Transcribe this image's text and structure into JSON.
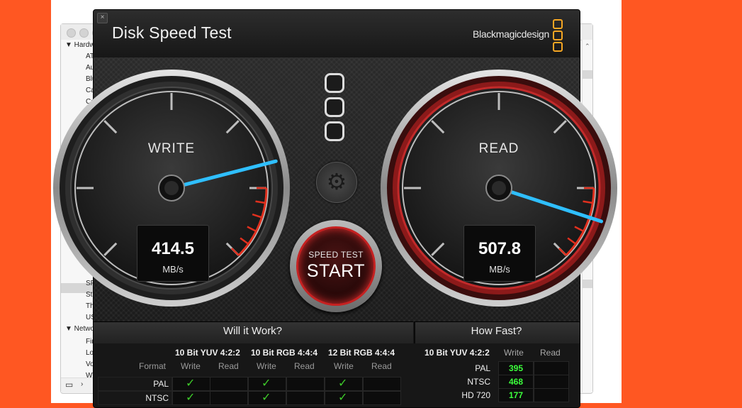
{
  "background_window": {
    "sidebar": [
      {
        "text": "Hardware",
        "type": "header"
      },
      {
        "text": "ATA",
        "type": "item"
      },
      {
        "text": "Audio",
        "type": "item"
      },
      {
        "text": "Bluetooth",
        "type": "item"
      },
      {
        "text": "Camera",
        "type": "item"
      },
      {
        "text": "Card Reader",
        "type": "item"
      },
      {
        "text": "SPI",
        "type": "item"
      },
      {
        "text": "Storage",
        "type": "item"
      },
      {
        "text": "Thunderbolt",
        "type": "item"
      },
      {
        "text": "USB",
        "type": "item"
      },
      {
        "text": "Network",
        "type": "header"
      },
      {
        "text": "Firewall",
        "type": "item"
      },
      {
        "text": "Locations",
        "type": "item"
      },
      {
        "text": "Volumes",
        "type": "item"
      },
      {
        "text": "WWAN",
        "type": "item"
      }
    ]
  },
  "app": {
    "title": "Disk Speed Test",
    "brand": "Blackmagicdesign",
    "close_glyph": "×",
    "icons": {
      "settings": "gear-icon",
      "presets": "stacked-squares-icon"
    }
  },
  "gauges": {
    "write": {
      "label": "WRITE",
      "value": "414.5",
      "unit": "MB/s",
      "needle_fraction": 0.78,
      "ring_color": "#2a2a2a"
    },
    "read": {
      "label": "READ",
      "value": "507.8",
      "unit": "MB/s",
      "needle_fraction": 0.9,
      "ring_color": "#7a1414"
    }
  },
  "start_button": {
    "small": "SPEED TEST",
    "big": "START"
  },
  "will_it_work": {
    "title": "Will it Work?",
    "format_header": "Format",
    "groups": [
      {
        "name": "10 Bit YUV 4:2:2",
        "write": "Write",
        "read": "Read"
      },
      {
        "name": "10 Bit RGB 4:4:4",
        "write": "Write",
        "read": "Read"
      },
      {
        "name": "12 Bit RGB 4:4:4",
        "write": "Write",
        "read": "Read"
      }
    ],
    "rows": [
      {
        "format": "PAL",
        "checks": [
          true,
          false,
          true,
          false,
          true,
          false
        ]
      },
      {
        "format": "NTSC",
        "checks": [
          true,
          false,
          true,
          false,
          true,
          false
        ]
      }
    ],
    "check_glyph": "✓"
  },
  "how_fast": {
    "title": "How Fast?",
    "group": "10 Bit YUV 4:2:2",
    "write": "Write",
    "read": "Read",
    "rows": [
      {
        "format": "PAL",
        "write": "395",
        "read": ""
      },
      {
        "format": "NTSC",
        "write": "468",
        "read": ""
      },
      {
        "format": "HD 720",
        "write": "177",
        "read": ""
      }
    ]
  }
}
